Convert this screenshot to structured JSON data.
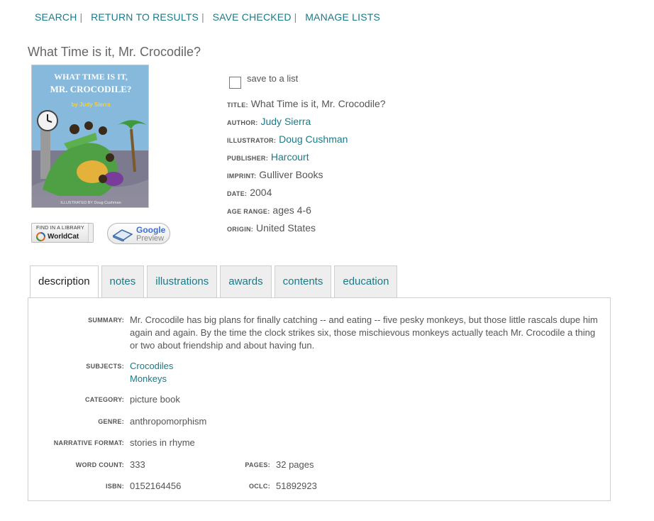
{
  "nav": {
    "search": "SEARCH",
    "return": "RETURN TO RESULTS",
    "save_checked": "SAVE CHECKED",
    "manage_lists": "MANAGE LISTS",
    "separator": "|"
  },
  "title": "What Time is it, Mr. Crocodile?",
  "cover": {
    "title_lines": [
      "WHAT TIME IS IT,",
      "MR. CROCODILE?"
    ],
    "author": "by Judy Sierra",
    "illustrator_line": "ILLUSTRATED BY Doug Cushman"
  },
  "badges": {
    "worldcat_small": "FIND IN A LIBRARY",
    "worldcat_big": "WorldCat",
    "google_top": "Google",
    "google_bottom": "Preview"
  },
  "save_to_list": "save to a list",
  "meta": {
    "title_label": "TITLE:",
    "title": "What Time is it, Mr. Crocodile?",
    "author_label": "AUTHOR:",
    "author": "Judy Sierra",
    "illustrator_label": "ILLUSTRATOR:",
    "illustrator": "Doug Cushman",
    "publisher_label": "PUBLISHER:",
    "publisher": "Harcourt",
    "imprint_label": "IMPRINT:",
    "imprint": "Gulliver Books",
    "date_label": "DATE:",
    "date": "2004",
    "age_label": "AGE RANGE:",
    "age": "ages 4-6",
    "origin_label": "ORIGIN:",
    "origin": "United States"
  },
  "tabs": [
    "description",
    "notes",
    "illustrations",
    "awards",
    "contents",
    "education"
  ],
  "details": {
    "summary_label": "SUMMARY:",
    "summary": "Mr. Crocodile has big plans for finally catching -- and eating -- five pesky monkeys, but those little rascals dupe him again and again. By the time the clock strikes six, those mischievous monkeys actually teach Mr. Crocodile a thing or two about friendship and about having fun.",
    "subjects_label": "SUBJECTS:",
    "subjects": [
      "Crocodiles",
      "Monkeys"
    ],
    "category_label": "CATEGORY:",
    "category": "picture book",
    "genre_label": "GENRE:",
    "genre": "anthropomorphism",
    "narrative_label": "NARRATIVE FORMAT:",
    "narrative": "stories in rhyme",
    "wordcount_label": "WORD COUNT:",
    "wordcount": "333",
    "pages_label": "PAGES:",
    "pages": "32 pages",
    "isbn_label": "ISBN:",
    "isbn": "0152164456",
    "oclc_label": "OCLC:",
    "oclc": "51892923"
  },
  "colors": {
    "link": "#1a7a8a",
    "text": "#555555",
    "border": "#cfcfcf",
    "tab_bg": "#eeeeee"
  }
}
